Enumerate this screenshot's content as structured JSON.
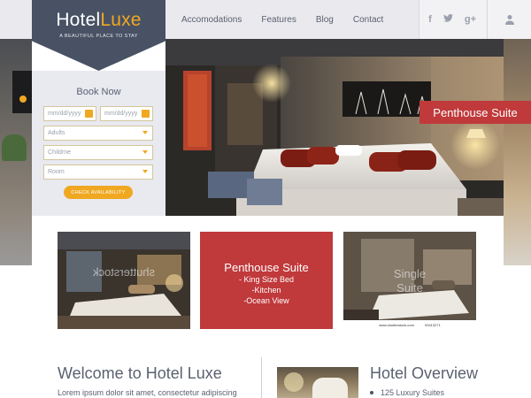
{
  "brand": {
    "name_part1": "Hotel",
    "name_part2": "Luxe",
    "tagline": "A BEAUTIFUL PLACE TO STAY",
    "accent_color": "#f0a821",
    "shield_color": "#485264"
  },
  "nav": {
    "items": [
      "Accomodations",
      "Features",
      "Blog",
      "Contact"
    ]
  },
  "social": {
    "facebook": "f",
    "twitter": "t",
    "googleplus": "g+"
  },
  "hero": {
    "promo_label": "Penthouse Suite",
    "promo_color": "#c0393b"
  },
  "booking": {
    "title": "Book Now",
    "checkin_placeholder": "mm/dd/yyyy",
    "checkout_placeholder": "mm/dd/yyyy",
    "adults": "Adults",
    "children": "Childrne",
    "room": "Room",
    "button": "CHECK AVAILABILITY"
  },
  "cards": {
    "left_watermark": "shutterstock",
    "feature": {
      "title": "Penthouse Suite",
      "lines": [
        "- King Size Bed",
        "-Kitchen",
        "-Ocean View"
      ]
    },
    "right_overlay": [
      "Single",
      "Suite"
    ],
    "right_caption_site": "www.shutterstock.com",
    "right_caption_id": "93413271"
  },
  "welcome": {
    "title": "Welcome to Hotel Luxe",
    "text": "Lorem ipsum dolor sit amet, consectetur adipiscing"
  },
  "overview": {
    "title": "Hotel Overview",
    "items": [
      "125 Luxury Suites"
    ]
  }
}
